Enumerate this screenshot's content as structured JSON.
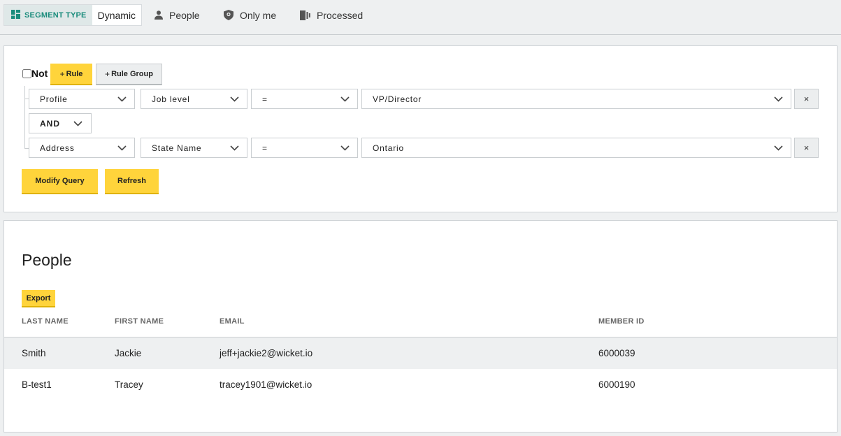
{
  "meta": {
    "segment_type_label": "SEGMENT TYPE",
    "segment_type_value": "Dynamic",
    "entity": "People",
    "visibility": "Only me",
    "status": "Processed"
  },
  "query": {
    "not_label": "Not",
    "add_rule_label": "Rule",
    "add_group_label": "Rule Group",
    "rules": [
      {
        "category": "Profile",
        "field": "Job level",
        "operator": "=",
        "value": "VP/Director",
        "remove": "×"
      },
      {
        "category": "Address",
        "field": "State Name",
        "operator": "=",
        "value": "Ontario",
        "remove": "×"
      }
    ],
    "conjunction": "AND",
    "modify_label": "Modify Query",
    "refresh_label": "Refresh"
  },
  "results": {
    "title": "People",
    "export_label": "Export",
    "columns": [
      "LAST NAME",
      "FIRST NAME",
      "EMAIL",
      "MEMBER ID"
    ],
    "rows": [
      [
        "Smith",
        "Jackie",
        "jeff+jackie2@wicket.io",
        "6000039"
      ],
      [
        "B-test1",
        "Tracey",
        "tracey1901@wicket.io",
        "6000190"
      ]
    ]
  },
  "colors": {
    "accent_yellow": "#ffd43b",
    "segment_teal": "#1a8c7c",
    "page_bg": "#eef0f1"
  },
  "icons": {
    "segment_type": "dashboard-icon",
    "entity": "person-icon",
    "visibility": "shield-lock-icon",
    "status": "processed-icon",
    "dropdown": "chevron-down-icon",
    "remove": "close-icon"
  }
}
